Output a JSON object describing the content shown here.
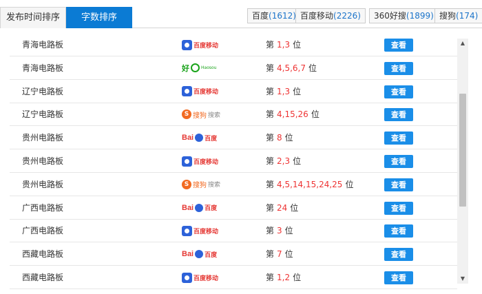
{
  "tabs": {
    "inactive": "发布时间排序",
    "active": "字数排序"
  },
  "filters": [
    {
      "label": "百度",
      "count": "(1612)"
    },
    {
      "label": "百度移动",
      "count": "(2226)"
    },
    {
      "label": "360好搜",
      "count": "(1899)"
    },
    {
      "label": "搜狗",
      "count": "(174)"
    }
  ],
  "rows": [
    {
      "region": "青海电路板",
      "engine": "baidu-mobile",
      "rank_prefix": "第",
      "rank": "1,3",
      "rank_suffix": "位",
      "button": "查看"
    },
    {
      "region": "青海电路板",
      "engine": "haosou",
      "rank_prefix": "第",
      "rank": "4,5,6,7",
      "rank_suffix": "位",
      "button": "查看"
    },
    {
      "region": "辽宁电路板",
      "engine": "baidu-mobile",
      "rank_prefix": "第",
      "rank": "1,3",
      "rank_suffix": "位",
      "button": "查看"
    },
    {
      "region": "辽宁电路板",
      "engine": "sogou",
      "rank_prefix": "第",
      "rank": "4,15,26",
      "rank_suffix": "位",
      "button": "查看"
    },
    {
      "region": "贵州电路板",
      "engine": "baidu",
      "rank_prefix": "第",
      "rank": "8",
      "rank_suffix": "位",
      "button": "查看"
    },
    {
      "region": "贵州电路板",
      "engine": "baidu-mobile",
      "rank_prefix": "第",
      "rank": "2,3",
      "rank_suffix": "位",
      "button": "查看"
    },
    {
      "region": "贵州电路板",
      "engine": "sogou",
      "rank_prefix": "第",
      "rank": "4,5,14,15,24,25",
      "rank_suffix": "位",
      "button": "查看"
    },
    {
      "region": "广西电路板",
      "engine": "baidu",
      "rank_prefix": "第",
      "rank": "24",
      "rank_suffix": "位",
      "button": "查看"
    },
    {
      "region": "广西电路板",
      "engine": "baidu-mobile",
      "rank_prefix": "第",
      "rank": "3",
      "rank_suffix": "位",
      "button": "查看"
    },
    {
      "region": "西藏电路板",
      "engine": "baidu",
      "rank_prefix": "第",
      "rank": "7",
      "rank_suffix": "位",
      "button": "查看"
    },
    {
      "region": "西藏电路板",
      "engine": "baidu-mobile",
      "rank_prefix": "第",
      "rank": "1,2",
      "rank_suffix": "位",
      "button": "查看"
    }
  ],
  "logos": {
    "baidu_mobile_text": "百度移动",
    "haosou_mark": "好",
    "haosou_small": "Haosou",
    "sogou_mark": "S",
    "sogou_text": "搜狗",
    "sogou_text2": "搜索",
    "baidu_bai": "Bai",
    "baidu_du": "百度"
  },
  "scrollbar": {
    "up": "▲",
    "down": "▼"
  }
}
